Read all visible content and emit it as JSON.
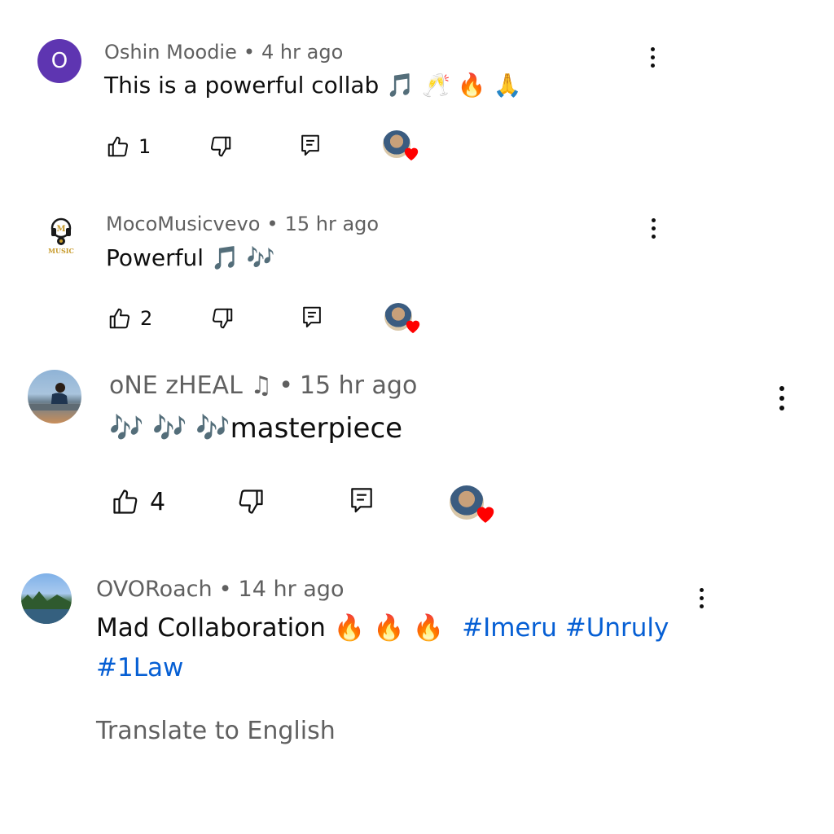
{
  "comments": [
    {
      "author": "Oshin Moodie",
      "time": "4 hr ago",
      "avatar_letter": "O",
      "text": "This is a powerful collab 🎵 🥂 🔥 🙏",
      "likes": "1"
    },
    {
      "author": "MocoMusicvevo",
      "time": "15 hr ago",
      "avatar_label": "MUSIC",
      "text": "Powerful 🎵 🎶",
      "likes": "2"
    },
    {
      "author": "oNE zHEAL ♫",
      "time": "15 hr ago",
      "text": "🎶 🎶 🎶masterpiece",
      "likes": "4"
    },
    {
      "author": "OVORoach",
      "time": "14 hr ago",
      "text": "Mad Collaboration 🔥 🔥 🔥",
      "hashtags_line1": "#Imeru #Unruly",
      "hashtags_line2": "#1Law",
      "translate": "Translate to English"
    }
  ],
  "icons": {
    "like": "thumbs-up-icon",
    "dislike": "thumbs-down-icon",
    "reply": "reply-icon",
    "more": "more-vert-icon",
    "creator_heart": "creator-heart-icon"
  },
  "colors": {
    "accent_avatar": "#5e35b1",
    "meta_text": "#606060",
    "hashtag": "#065fd4",
    "heart": "#ff0000"
  }
}
